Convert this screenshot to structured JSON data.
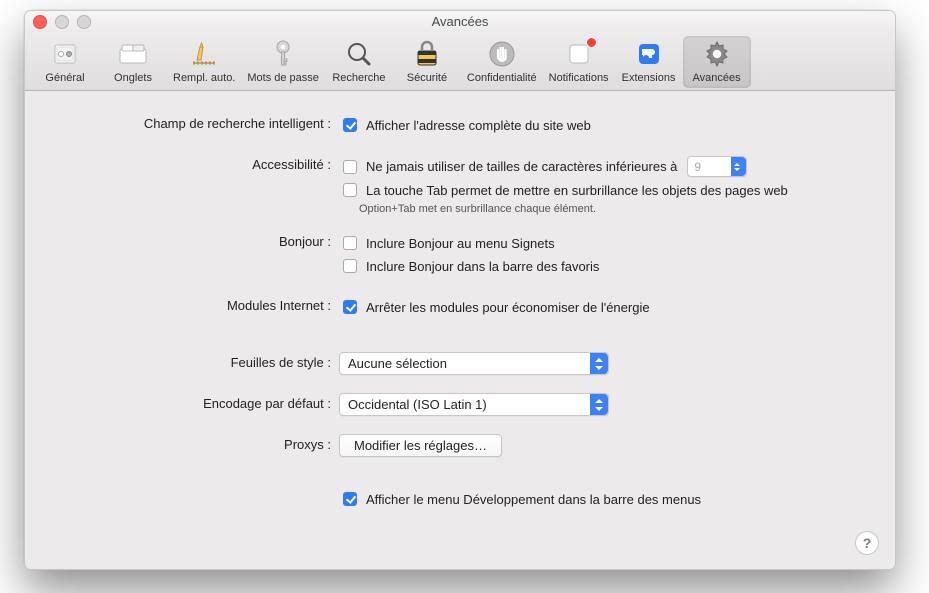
{
  "window": {
    "title": "Avancées"
  },
  "toolbar": [
    {
      "label": "Général"
    },
    {
      "label": "Onglets"
    },
    {
      "label": "Rempl. auto."
    },
    {
      "label": "Mots de passe"
    },
    {
      "label": "Recherche"
    },
    {
      "label": "Sécurité"
    },
    {
      "label": "Confidentialité"
    },
    {
      "label": "Notifications"
    },
    {
      "label": "Extensions"
    },
    {
      "label": "Avancées"
    }
  ],
  "sections": {
    "smartSearch": {
      "label": "Champ de recherche intelligent :",
      "showFullAddress": "Afficher l'adresse complète du site web"
    },
    "accessibility": {
      "label": "Accessibilité :",
      "neverSmaller": "Ne jamais utiliser de tailles de caractères inférieures à",
      "fontSize": "9",
      "tabHighlights": "La touche Tab permet de mettre en surbrillance les objets des pages web",
      "hint": "Option+Tab met en surbrillance chaque élément."
    },
    "bonjour": {
      "label": "Bonjour :",
      "bookmarks": "Inclure Bonjour au menu Signets",
      "favorites": "Inclure Bonjour dans la barre des favoris"
    },
    "plugins": {
      "label": "Modules Internet :",
      "stop": "Arrêter les modules pour économiser de l'énergie"
    },
    "stylesheet": {
      "label": "Feuilles de style :",
      "value": "Aucune sélection"
    },
    "encoding": {
      "label": "Encodage par défaut :",
      "value": "Occidental (ISO Latin 1)"
    },
    "proxies": {
      "label": "Proxys :",
      "button": "Modifier les réglages…"
    },
    "develop": {
      "show": "Afficher le menu Développement dans la barre des menus"
    }
  }
}
